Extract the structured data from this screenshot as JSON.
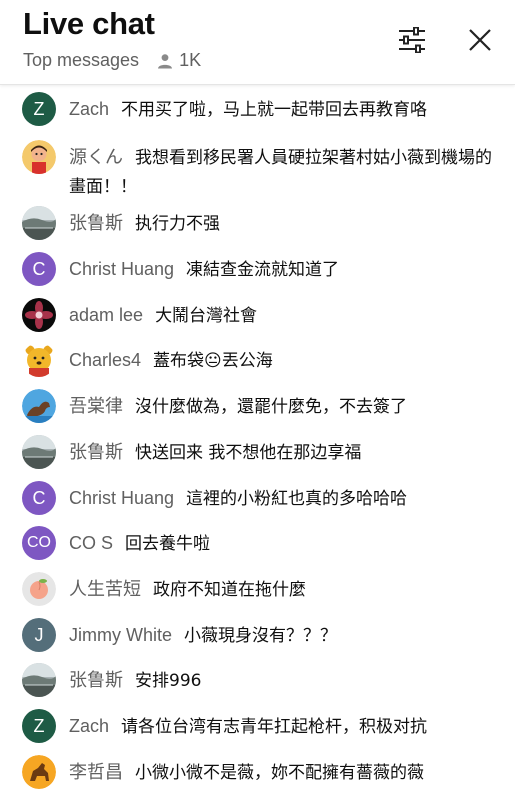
{
  "header": {
    "title": "Live chat",
    "mode_label": "Top messages",
    "viewer_count": "1K",
    "icons": {
      "viewers": "person-icon",
      "filter": "tune-icon",
      "close": "close-icon"
    }
  },
  "colors": {
    "accent_green": "#1e5b45",
    "accent_purple": "#7e57c2",
    "accent_slate": "#546e7a"
  },
  "messages": [
    {
      "author": "Zach",
      "text": "不用买了啦，马上就一起带回去再教育咯",
      "avatar": {
        "kind": "letter",
        "letter": "Z",
        "color": "#1e5b45"
      }
    },
    {
      "author": "源くん",
      "text": "我想看到移民署人員硬拉架著村姑小薇到機場的畫面！！",
      "avatar": {
        "kind": "image",
        "image": "cartoon-boy"
      }
    },
    {
      "author": "张鲁斯",
      "text": "执行力不强",
      "avatar": {
        "kind": "image",
        "image": "landscape"
      }
    },
    {
      "author": "Christ Huang",
      "text": "凍結查金流就知道了",
      "avatar": {
        "kind": "letter",
        "letter": "C",
        "color": "#7e57c2"
      }
    },
    {
      "author": "adam lee",
      "text": "大鬧台灣社會",
      "avatar": {
        "kind": "image",
        "image": "flower-dark"
      }
    },
    {
      "author": "Charles4",
      "text": "蓋布袋😐丟公海",
      "avatar": {
        "kind": "image",
        "image": "bear"
      }
    },
    {
      "author": "吾棠律",
      "text": "沒什麼做為，還罷什麼免，不去簽了",
      "avatar": {
        "kind": "image",
        "image": "seal"
      }
    },
    {
      "author": "张鲁斯",
      "text": "快送回来 我不想他在那边享福",
      "avatar": {
        "kind": "image",
        "image": "landscape"
      }
    },
    {
      "author": "Christ Huang",
      "text": "這裡的小粉紅也真的多哈哈哈",
      "avatar": {
        "kind": "letter",
        "letter": "C",
        "color": "#7e57c2"
      }
    },
    {
      "author": "CO S",
      "text": "回去養牛啦",
      "avatar": {
        "kind": "letter",
        "letter": "CO",
        "color": "#7e57c2"
      }
    },
    {
      "author": "人生苦短",
      "text": "政府不知道在拖什麼",
      "avatar": {
        "kind": "image",
        "image": "peach"
      }
    },
    {
      "author": "Jimmy White",
      "text": "小薇現身沒有？？？",
      "avatar": {
        "kind": "letter",
        "letter": "J",
        "color": "#546e7a"
      }
    },
    {
      "author": "张鲁斯",
      "text": "安排996",
      "avatar": {
        "kind": "image",
        "image": "landscape"
      }
    },
    {
      "author": "Zach",
      "text": "请各位台湾有志青年扛起枪杆，积极对抗",
      "avatar": {
        "kind": "letter",
        "letter": "Z",
        "color": "#1e5b45"
      }
    },
    {
      "author": "李哲昌",
      "text": "小微小微不是薇，妳不配擁有薔薇的薇",
      "avatar": {
        "kind": "image",
        "image": "horse"
      }
    }
  ]
}
